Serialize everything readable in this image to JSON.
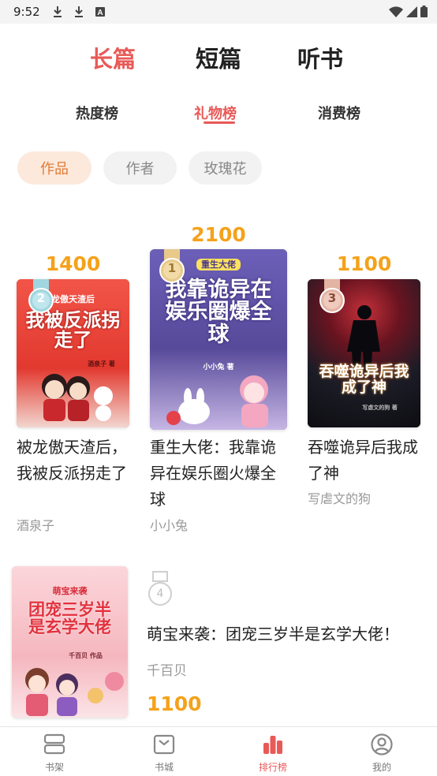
{
  "status_bar": {
    "time": "9:52",
    "icons": [
      "download-icon",
      "download-icon",
      "a-icon",
      "wifi-icon",
      "signal-icon",
      "battery-icon"
    ]
  },
  "main_tabs": [
    {
      "label": "长篇",
      "active": true
    },
    {
      "label": "短篇",
      "active": false
    },
    {
      "label": "听书",
      "active": false
    }
  ],
  "sub_tabs": [
    {
      "label": "热度榜",
      "active": false
    },
    {
      "label": "礼物榜",
      "active": true
    },
    {
      "label": "消费榜",
      "active": false
    }
  ],
  "filters": [
    {
      "label": "作品",
      "active": true
    },
    {
      "label": "作者",
      "active": false
    },
    {
      "label": "玫瑰花",
      "active": false
    }
  ],
  "ranking": [
    {
      "rank": "1",
      "score": "2100",
      "title": "重生大佬：我靠诡异在娱乐圈火爆全球",
      "author": "小小兔",
      "cover_text": "我靠诡异在娱乐圈爆全球",
      "cover_badge": "重生大佬",
      "cover_author": "小小兔 著",
      "cover_bg": "#5a4d9c"
    },
    {
      "rank": "2",
      "score": "1400",
      "title": "被龙傲天渣后，我被反派拐走了",
      "author": "酒泉子",
      "cover_text": "我被反派拐走了",
      "cover_badge": "龙傲天渣后",
      "cover_author": "酒泉子 著",
      "cover_bg": "#e5413a"
    },
    {
      "rank": "3",
      "score": "1100",
      "title": "吞噬诡异后我成了神",
      "author": "写虐文的狗",
      "cover_text": "吞噬诡异后我成了神",
      "cover_author": "写虐文的狗 著",
      "cover_bg": "#1d1d26"
    },
    {
      "rank": "4",
      "score": "1100",
      "title": "萌宝来袭：团宠三岁半是玄学大佬！",
      "author": "千百贝",
      "cover_text": "团宠三岁半是玄学大佬",
      "cover_badge": "萌宝来袭",
      "cover_author": "千百贝 作品",
      "cover_bg": "#f7c2c8"
    }
  ],
  "tabbar": [
    {
      "label": "书架",
      "icon": "bookshelf-icon",
      "active": false
    },
    {
      "label": "书城",
      "icon": "bookstore-icon",
      "active": false
    },
    {
      "label": "排行榜",
      "icon": "ranking-icon",
      "active": true
    },
    {
      "label": "我的",
      "icon": "profile-icon",
      "active": false
    }
  ],
  "colors": {
    "accent": "#e85a57",
    "score": "#f4a21b",
    "chip_active_bg": "#fde9dc",
    "chip_active_text": "#e07a35",
    "gold": "#e8c98a",
    "silver": "#9fd6df",
    "bronze": "#e3b4a3"
  }
}
